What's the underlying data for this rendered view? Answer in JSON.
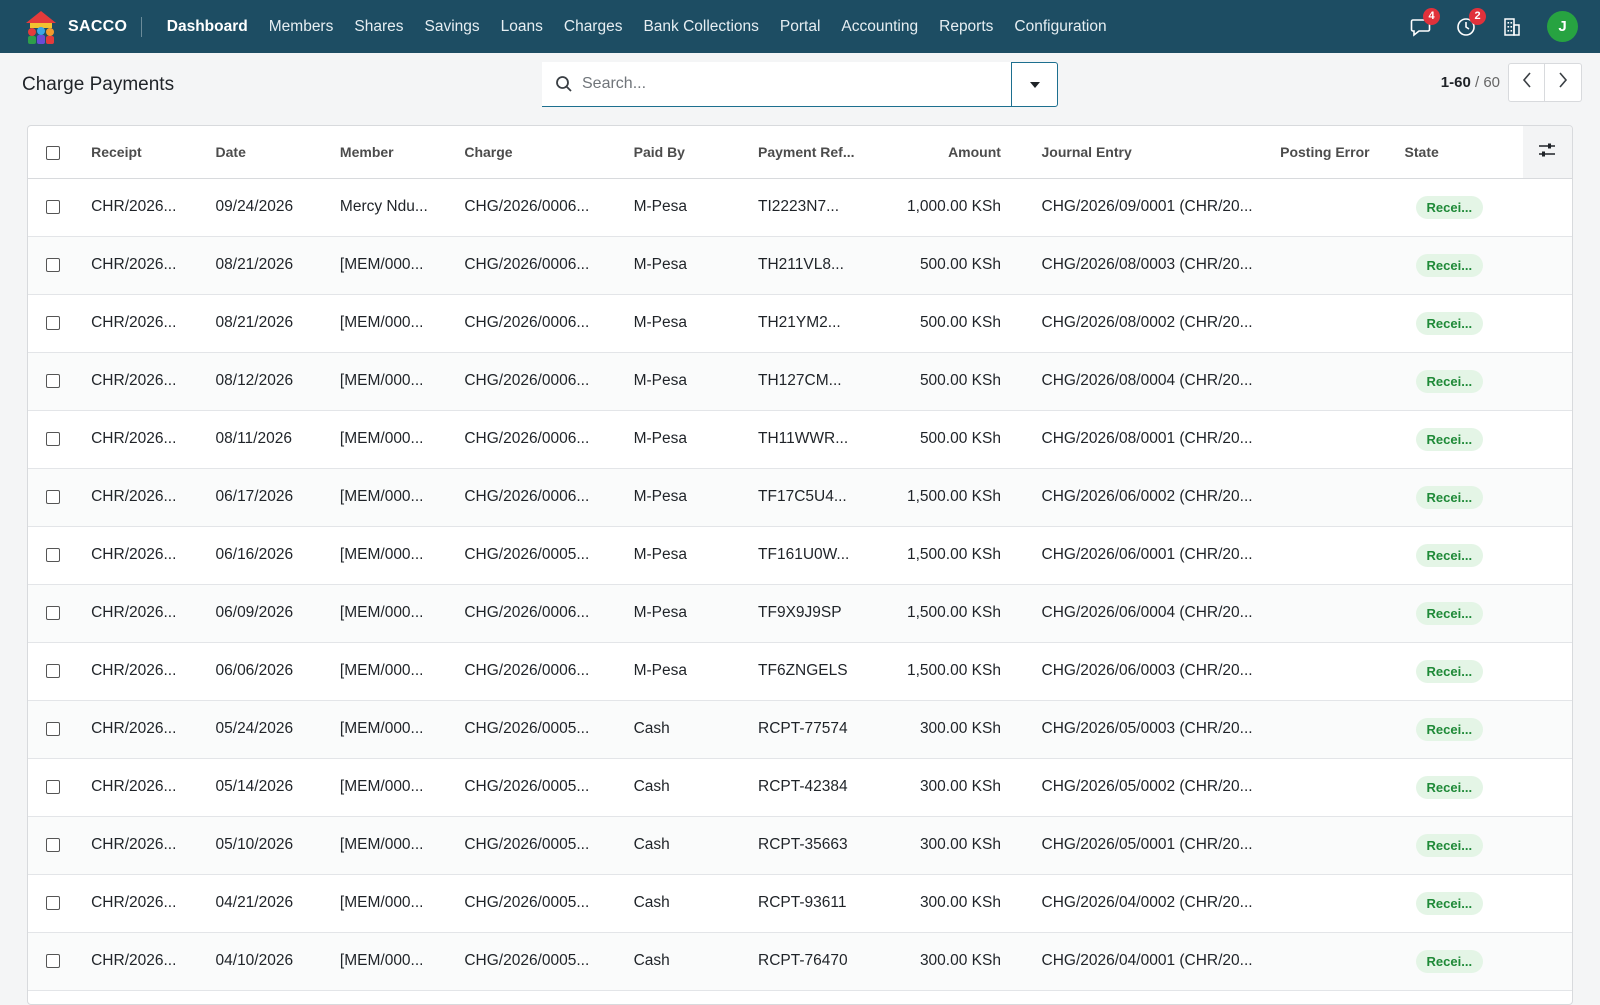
{
  "navbar": {
    "brand": "SACCO",
    "menu": [
      "Dashboard",
      "Members",
      "Shares",
      "Savings",
      "Loans",
      "Charges",
      "Bank Collections",
      "Portal",
      "Accounting",
      "Reports",
      "Configuration"
    ],
    "messages_count": "4",
    "activities_count": "2",
    "avatar_letter": "J"
  },
  "control": {
    "title": "Charge Payments",
    "search_placeholder": "Search...",
    "pager_value": "1-60",
    "pager_sep": " / ",
    "pager_total": "60"
  },
  "table": {
    "columns": [
      "Receipt",
      "Date",
      "Member",
      "Charge",
      "Paid By",
      "Payment Ref...",
      "Amount",
      "Journal Entry",
      "Posting Error",
      "State"
    ],
    "rows": [
      {
        "receipt": "CHR/2026...",
        "date": "09/24/2026",
        "member": "Mercy Ndu...",
        "charge": "CHG/2026/0006...",
        "paid_by": "M-Pesa",
        "payment_ref": "TI2223N7...",
        "amount": "1,000.00 KSh",
        "journal_entry": "CHG/2026/09/0001 (CHR/20...",
        "posting_error": "",
        "state": "Recei..."
      },
      {
        "receipt": "CHR/2026...",
        "date": "08/21/2026",
        "member": "[MEM/000...",
        "charge": "CHG/2026/0006...",
        "paid_by": "M-Pesa",
        "payment_ref": "TH211VL8...",
        "amount": "500.00 KSh",
        "journal_entry": "CHG/2026/08/0003 (CHR/20...",
        "posting_error": "",
        "state": "Recei..."
      },
      {
        "receipt": "CHR/2026...",
        "date": "08/21/2026",
        "member": "[MEM/000...",
        "charge": "CHG/2026/0006...",
        "paid_by": "M-Pesa",
        "payment_ref": "TH21YM2...",
        "amount": "500.00 KSh",
        "journal_entry": "CHG/2026/08/0002 (CHR/20...",
        "posting_error": "",
        "state": "Recei..."
      },
      {
        "receipt": "CHR/2026...",
        "date": "08/12/2026",
        "member": "[MEM/000...",
        "charge": "CHG/2026/0006...",
        "paid_by": "M-Pesa",
        "payment_ref": "TH127CM...",
        "amount": "500.00 KSh",
        "journal_entry": "CHG/2026/08/0004 (CHR/20...",
        "posting_error": "",
        "state": "Recei..."
      },
      {
        "receipt": "CHR/2026...",
        "date": "08/11/2026",
        "member": "[MEM/000...",
        "charge": "CHG/2026/0006...",
        "paid_by": "M-Pesa",
        "payment_ref": "TH11WWR...",
        "amount": "500.00 KSh",
        "journal_entry": "CHG/2026/08/0001 (CHR/20...",
        "posting_error": "",
        "state": "Recei..."
      },
      {
        "receipt": "CHR/2026...",
        "date": "06/17/2026",
        "member": "[MEM/000...",
        "charge": "CHG/2026/0006...",
        "paid_by": "M-Pesa",
        "payment_ref": "TF17C5U4...",
        "amount": "1,500.00 KSh",
        "journal_entry": "CHG/2026/06/0002 (CHR/20...",
        "posting_error": "",
        "state": "Recei..."
      },
      {
        "receipt": "CHR/2026...",
        "date": "06/16/2026",
        "member": "[MEM/000...",
        "charge": "CHG/2026/0005...",
        "paid_by": "M-Pesa",
        "payment_ref": "TF161U0W...",
        "amount": "1,500.00 KSh",
        "journal_entry": "CHG/2026/06/0001 (CHR/20...",
        "posting_error": "",
        "state": "Recei..."
      },
      {
        "receipt": "CHR/2026...",
        "date": "06/09/2026",
        "member": "[MEM/000...",
        "charge": "CHG/2026/0006...",
        "paid_by": "M-Pesa",
        "payment_ref": "TF9X9J9SP",
        "amount": "1,500.00 KSh",
        "journal_entry": "CHG/2026/06/0004 (CHR/20...",
        "posting_error": "",
        "state": "Recei..."
      },
      {
        "receipt": "CHR/2026...",
        "date": "06/06/2026",
        "member": "[MEM/000...",
        "charge": "CHG/2026/0006...",
        "paid_by": "M-Pesa",
        "payment_ref": "TF6ZNGELS",
        "amount": "1,500.00 KSh",
        "journal_entry": "CHG/2026/06/0003 (CHR/20...",
        "posting_error": "",
        "state": "Recei..."
      },
      {
        "receipt": "CHR/2026...",
        "date": "05/24/2026",
        "member": "[MEM/000...",
        "charge": "CHG/2026/0005...",
        "paid_by": "Cash",
        "payment_ref": "RCPT-77574",
        "amount": "300.00 KSh",
        "journal_entry": "CHG/2026/05/0003 (CHR/20...",
        "posting_error": "",
        "state": "Recei..."
      },
      {
        "receipt": "CHR/2026...",
        "date": "05/14/2026",
        "member": "[MEM/000...",
        "charge": "CHG/2026/0005...",
        "paid_by": "Cash",
        "payment_ref": "RCPT-42384",
        "amount": "300.00 KSh",
        "journal_entry": "CHG/2026/05/0002 (CHR/20...",
        "posting_error": "",
        "state": "Recei..."
      },
      {
        "receipt": "CHR/2026...",
        "date": "05/10/2026",
        "member": "[MEM/000...",
        "charge": "CHG/2026/0005...",
        "paid_by": "Cash",
        "payment_ref": "RCPT-35663",
        "amount": "300.00 KSh",
        "journal_entry": "CHG/2026/05/0001 (CHR/20...",
        "posting_error": "",
        "state": "Recei..."
      },
      {
        "receipt": "CHR/2026...",
        "date": "04/21/2026",
        "member": "[MEM/000...",
        "charge": "CHG/2026/0005...",
        "paid_by": "Cash",
        "payment_ref": "RCPT-93611",
        "amount": "300.00 KSh",
        "journal_entry": "CHG/2026/04/0002 (CHR/20...",
        "posting_error": "",
        "state": "Recei..."
      },
      {
        "receipt": "CHR/2026...",
        "date": "04/10/2026",
        "member": "[MEM/000...",
        "charge": "CHG/2026/0005...",
        "paid_by": "Cash",
        "payment_ref": "RCPT-76470",
        "amount": "300.00 KSh",
        "journal_entry": "CHG/2026/04/0001 (CHR/20...",
        "posting_error": "",
        "state": "Recei..."
      }
    ]
  },
  "colors": {
    "navbar_bg": "#1d4d63",
    "badge_red": "#e0313b",
    "avatar_green": "#27a341",
    "state_badge_bg": "#e4f5e6",
    "state_badge_text": "#1f8a38"
  },
  "icons": {
    "logo": "sacco-logo-icon",
    "messages": "chat-bubble-icon",
    "activities": "clock-icon",
    "company": "building-icon",
    "search": "search-icon",
    "search_toggle": "caret-down-icon",
    "pager_prev": "chevron-left-icon",
    "pager_next": "chevron-right-icon",
    "optional_columns": "sliders-icon"
  }
}
